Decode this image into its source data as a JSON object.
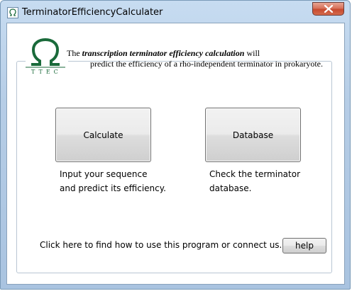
{
  "window": {
    "title": "TerminatorEfficiencyCalculater"
  },
  "header": {
    "logo_text": "TTEC",
    "line1_prefix": "The",
    "line1_bold": "transcription terminator efficiency calculation",
    "line1_suffix": "will",
    "line2": "predict the efficiency of  a rho-independent terminator in prokaryote."
  },
  "actions": {
    "calculate_label": "Calculate",
    "calculate_desc_line1": "Input your sequence",
    "calculate_desc_line2": "and predict its efficiency.",
    "database_label": "Database",
    "database_desc_line1": "Check the terminator",
    "database_desc_line2": "database."
  },
  "footer": {
    "help_text": "Click here to find how to use this program or connect us.",
    "help_label": "help"
  },
  "colors": {
    "logo_green": "#1a6a3a",
    "close_red": "#c74a2f"
  }
}
